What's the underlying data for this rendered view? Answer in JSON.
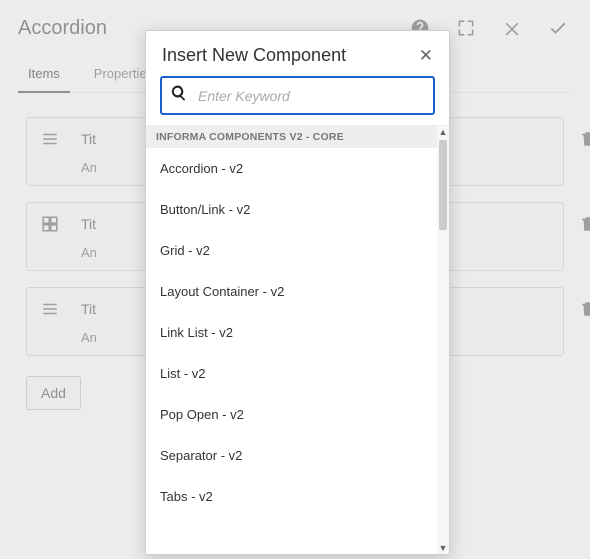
{
  "header": {
    "title": "Accordion"
  },
  "tabs": [
    {
      "label": "Items",
      "active": true
    },
    {
      "label": "Properties",
      "active": false
    }
  ],
  "items": [
    {
      "icon": "list",
      "title": "Tit",
      "answer": "An"
    },
    {
      "icon": "grid",
      "title": "Tit",
      "answer": "An"
    },
    {
      "icon": "list",
      "title": "Tit",
      "answer": "An"
    }
  ],
  "add_button": "Add",
  "modal": {
    "title": "Insert New Component",
    "search_placeholder": "Enter Keyword",
    "group_header": "INFORMA COMPONENTS V2 - CORE",
    "components": [
      "Accordion - v2",
      "Button/Link - v2",
      "Grid - v2",
      "Layout Container - v2",
      "Link List - v2",
      "List - v2",
      "Pop Open - v2",
      "Separator - v2",
      "Tabs - v2"
    ]
  }
}
